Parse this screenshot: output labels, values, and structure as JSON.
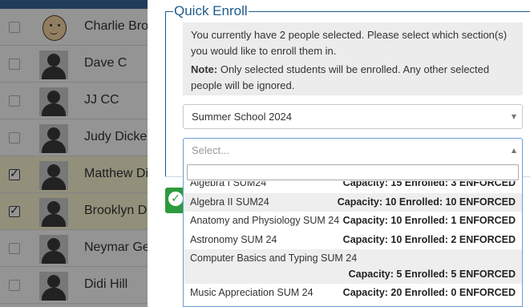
{
  "students": [
    {
      "name": "Charlie Brown",
      "checked": false,
      "avatar": "cartoon-avatar",
      "selected": false
    },
    {
      "name": "Dave C",
      "checked": false,
      "avatar": "person-silhouette-icon",
      "selected": false
    },
    {
      "name": "JJ CC",
      "checked": false,
      "avatar": "person-silhouette-icon",
      "selected": false
    },
    {
      "name": "Judy Dickerson",
      "checked": false,
      "avatar": "person-silhouette-icon",
      "selected": false
    },
    {
      "name": "Matthew Dixon",
      "checked": true,
      "avatar": "person-silhouette-icon",
      "selected": true
    },
    {
      "name": "Brooklyn Duncan",
      "checked": true,
      "avatar": "person-silhouette-icon",
      "selected": true
    },
    {
      "name": "Neymar Germain",
      "checked": false,
      "avatar": "person-silhouette-icon",
      "selected": false
    },
    {
      "name": "Didi Hill",
      "checked": false,
      "avatar": "person-silhouette-icon",
      "selected": false
    }
  ],
  "modal": {
    "legend": "Quick Enroll",
    "info_line1": "You currently have 2 people selected. Please select which section(s) you would like to enroll them in.",
    "note_label": "Note:",
    "note_text": " Only selected students will be enrolled. Any other selected people will be ignored.",
    "session_select_value": "Summer School 2024",
    "section_select_placeholder": "Select...",
    "confirm_icon": "checkmark-icon"
  },
  "sections": [
    {
      "name": "Algebra I SUM24",
      "capacity": "Capacity: 15 Enrolled: 3 ENFORCED",
      "highlighted": false,
      "wrapped": false
    },
    {
      "name": "Algebra II SUM24",
      "capacity": "Capacity: 10 Enrolled: 10 ENFORCED",
      "highlighted": true,
      "wrapped": false
    },
    {
      "name": "Anatomy and Physiology SUM 24",
      "capacity": "Capacity: 10 Enrolled: 1 ENFORCED",
      "highlighted": false,
      "wrapped": false
    },
    {
      "name": "Astronomy SUM 24",
      "capacity": "Capacity: 10 Enrolled: 2 ENFORCED",
      "highlighted": false,
      "wrapped": false
    },
    {
      "name": "Computer Basics and Typing SUM 24",
      "capacity": "Capacity: 5 Enrolled: 5 ENFORCED",
      "highlighted": true,
      "wrapped": true
    },
    {
      "name": "Music Appreciation SUM 24",
      "capacity": "Capacity: 20 Enrolled: 0 ENFORCED",
      "highlighted": false,
      "wrapped": false
    }
  ],
  "colors": {
    "accent": "#1d5b8c",
    "confirm_green": "#2e9a3f",
    "selected_row": "#fcf8d4"
  }
}
